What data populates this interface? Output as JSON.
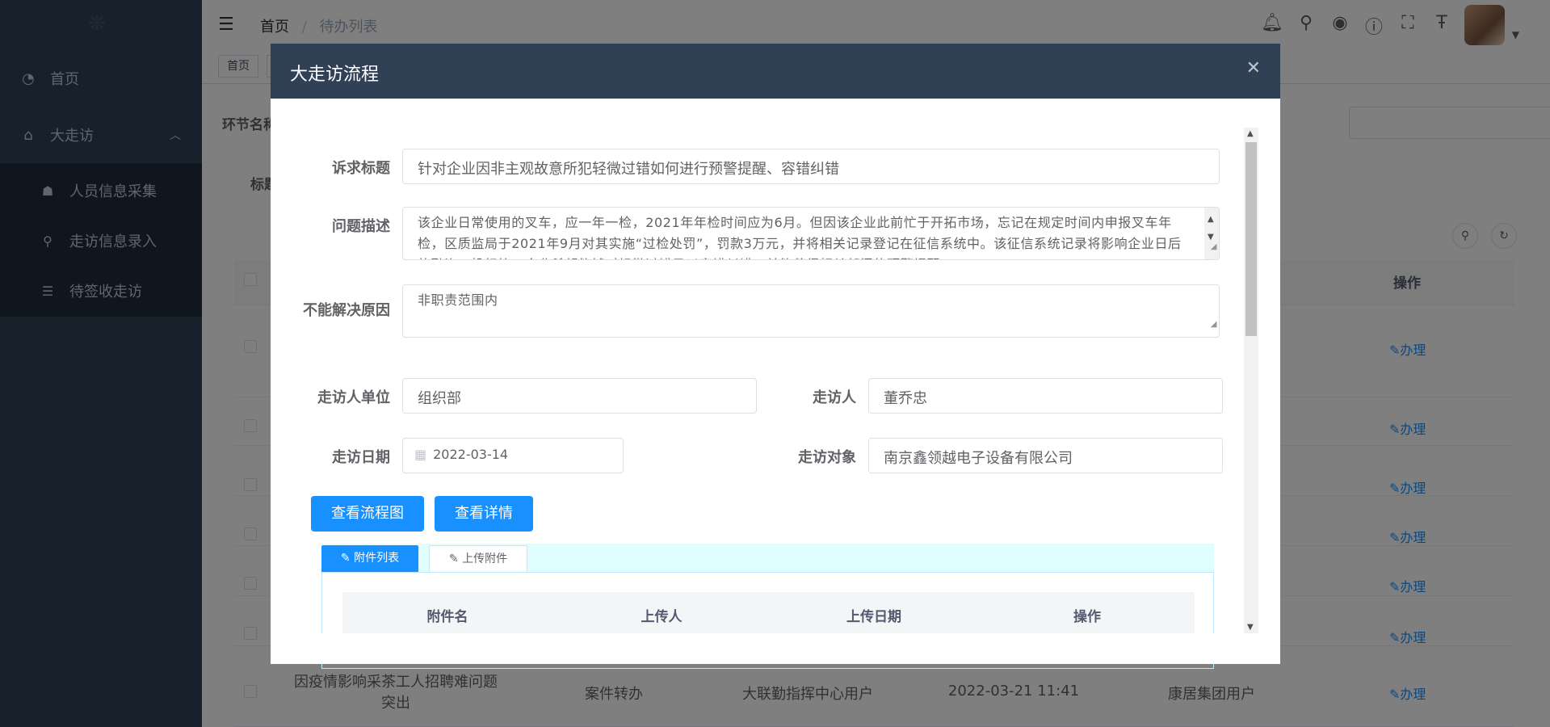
{
  "sidebar": {
    "items": [
      {
        "label": "首页",
        "icon": "dashboard-icon"
      },
      {
        "label": "大走访",
        "icon": "visit-icon",
        "expanded": true
      }
    ],
    "subitems": [
      {
        "label": "人员信息采集",
        "icon": "peoples-icon"
      },
      {
        "label": "走访信息录入",
        "icon": "tree-icon"
      },
      {
        "label": "待签收走访",
        "icon": "list-icon"
      }
    ]
  },
  "header": {
    "breadcrumb_home": "首页",
    "breadcrumb_separator": "/",
    "breadcrumb_current": "待办列表",
    "icons": [
      "bell-icon",
      "search-icon",
      "github-icon",
      "question-icon",
      "fullscreen-icon",
      "text-size-icon"
    ]
  },
  "tags": {
    "home": "首页"
  },
  "page": {
    "filter_node_label": "环节名称",
    "filter_title_label": "标题",
    "op_header": "操作",
    "do_label": "办理",
    "last_row": {
      "title": "因疫情影响采茶工人招聘难问题突出",
      "node": "案件转办",
      "sender": "大联勤指挥中心用户",
      "time": "2022-03-21 11:41",
      "receiver": "康居集团用户"
    }
  },
  "dialog": {
    "title": "大走访流程",
    "close_icon": "close-icon",
    "fields": {
      "appeal_title_label": "诉求标题",
      "appeal_title_value": "针对企业因非主观故意所犯轻微过错如何进行预警提醒、容错纠错",
      "description_label": "问题描述",
      "description_value": "该企业日常使用的叉车，应一年一检，2021年年检时间应为6月。但因该企业此前忙于开拓市场，忘记在规定时间内申报叉车年检，区质监局于2021年9月对其实施“过检处罚”，罚款3万元，并将相关记录登记在征信系统中。该征信系统记录将影响企业日后的融资、投标等，企业希望能够对轻微过错予以容错纠错，并能获得相关部门的预警提醒。",
      "unresolvable_label": "不能解决原因",
      "unresolvable_value": "非职责范围内",
      "visitor_unit_label": "走访人单位",
      "visitor_unit_value": "组织部",
      "visitor_label": "走访人",
      "visitor_value": "董乔忠",
      "visit_date_label": "走访日期",
      "visit_date_value": "2022-03-14",
      "visit_target_label": "走访对象",
      "visit_target_value": "南京鑫领越电子设备有限公司"
    },
    "buttons": {
      "flowchart": "查看流程图",
      "details": "查看详情"
    },
    "tabs": {
      "attachment_list": "附件列表",
      "upload_attachment": "上传附件"
    },
    "attachment_table": {
      "headers": [
        "附件名",
        "上传人",
        "上传日期",
        "操作"
      ]
    }
  },
  "colors": {
    "sidebar_bg": "#304156",
    "submenu_bg": "#1f2d3d",
    "primary": "#1890ff",
    "dialog_header": "#304156"
  }
}
